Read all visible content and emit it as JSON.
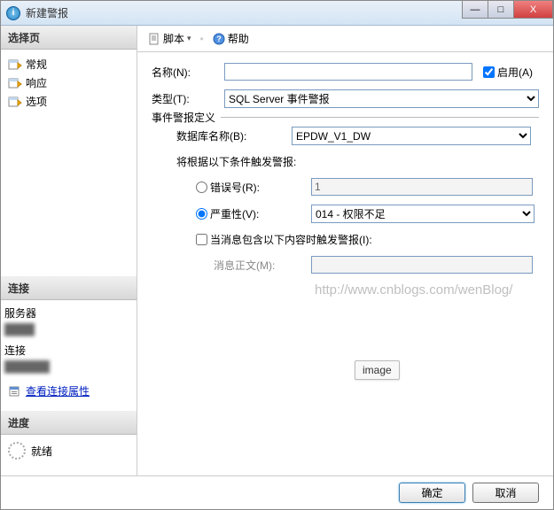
{
  "window": {
    "title": "新建警报",
    "btn_min": "—",
    "btn_max": "□",
    "btn_close": "X"
  },
  "sidebar": {
    "select_page": {
      "header": "选择页",
      "items": [
        "常规",
        "响应",
        "选项"
      ]
    },
    "connection": {
      "header": "连接",
      "server_label": "服务器",
      "conn_label": "连接",
      "view_props": "查看连接属性"
    },
    "progress": {
      "header": "进度",
      "status": "就绪"
    }
  },
  "toolbar": {
    "script": "脚本",
    "help": "帮助"
  },
  "form": {
    "name_label": "名称(N):",
    "name_value": "",
    "enable_label": "启用(A)",
    "enable_checked": true,
    "type_label": "类型(T):",
    "type_value": "SQL Server 事件警报",
    "def_legend": "事件警报定义",
    "db_label": "数据库名称(B):",
    "db_value": "EPDW_V1_DW",
    "cond_label": "将根据以下条件触发警报:",
    "errno_label": "错误号(R):",
    "errno_value": "1",
    "sev_label": "严重性(V):",
    "sev_value": "014 - 权限不足",
    "radio_selected": "severity",
    "msg_trigger_label": "当消息包含以下内容时触发警报(I):",
    "msg_trigger_checked": false,
    "msg_text_label": "消息正文(M):",
    "msg_text_value": ""
  },
  "watermark": "http://www.cnblogs.com/wenBlog/",
  "imagetag": "image",
  "buttons": {
    "ok": "确定",
    "cancel": "取消"
  }
}
